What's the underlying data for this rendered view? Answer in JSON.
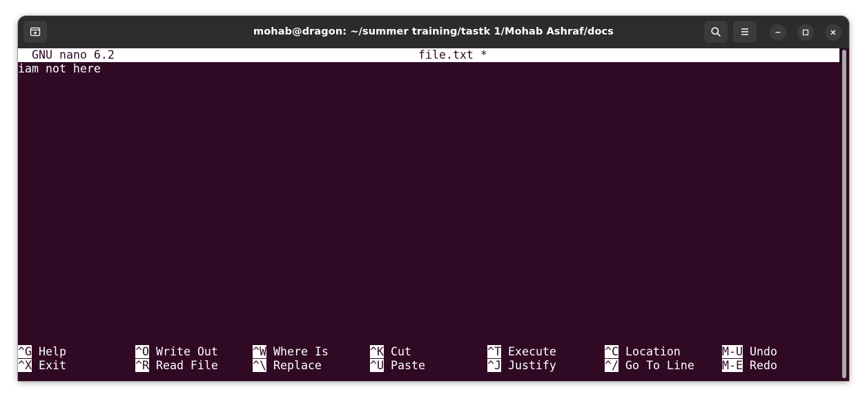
{
  "window": {
    "title": "mohab@dragon: ~/summer training/tastk 1/Mohab Ashraf/docs"
  },
  "titlebar_icons": {
    "new_tab": "new-tab-icon",
    "search": "search-icon",
    "menu": "hamburger-menu-icon",
    "minimize": "minimize-icon",
    "maximize": "maximize-icon",
    "close": "close-icon"
  },
  "nano": {
    "version": "GNU nano 6.2",
    "filename": "file.txt *",
    "content_lines": [
      "iam not here"
    ]
  },
  "shortcuts": {
    "row1": [
      {
        "key": "^G",
        "label": "Help"
      },
      {
        "key": "^O",
        "label": "Write Out"
      },
      {
        "key": "^W",
        "label": "Where Is"
      },
      {
        "key": "^K",
        "label": "Cut"
      },
      {
        "key": "^T",
        "label": "Execute"
      },
      {
        "key": "^C",
        "label": "Location"
      },
      {
        "key": "M-U",
        "label": "Undo"
      }
    ],
    "row2": [
      {
        "key": "^X",
        "label": "Exit"
      },
      {
        "key": "^R",
        "label": "Read File"
      },
      {
        "key": "^\\",
        "label": "Replace"
      },
      {
        "key": "^U",
        "label": "Paste"
      },
      {
        "key": "^J",
        "label": "Justify"
      },
      {
        "key": "^/",
        "label": "Go To Line"
      },
      {
        "key": "M-E",
        "label": "Redo"
      }
    ]
  },
  "colors": {
    "terminal_bg": "#300a24",
    "titlebar_bg": "#2c2c2c",
    "text": "#ffffff"
  }
}
